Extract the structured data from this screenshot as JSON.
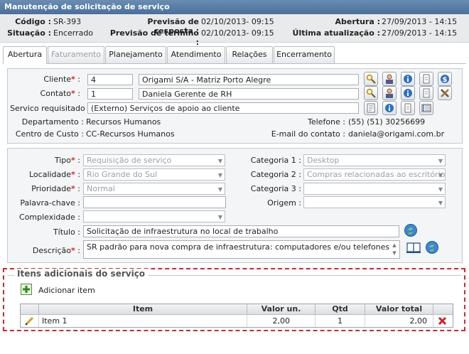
{
  "window": {
    "title": "Manutenção de solicitação de serviço"
  },
  "header": {
    "codigo_label": "Código :",
    "codigo": "SR-393",
    "situacao_label": "Situação :",
    "situacao": "Encerrado",
    "prev_resp_label": "Previsão de resposta :",
    "prev_resp": "02/10/2013- 09:15",
    "prev_term_label": "Previsão de término :",
    "prev_term": "02/10/2013- 09:15",
    "abertura_label": "Abertura :",
    "abertura": "27/09/2013 - 14:15",
    "ultima_label": "Última atualização :",
    "ultima": "27/09/2013 - 14:15"
  },
  "tabs": [
    {
      "label": "Abertura",
      "active": true
    },
    {
      "label": "Faturamento",
      "disabled": true
    },
    {
      "label": "Planejamento"
    },
    {
      "label": "Atendimento"
    },
    {
      "label": "Relações"
    },
    {
      "label": "Encerramento"
    }
  ],
  "client": {
    "cliente_label": "Cliente",
    "cliente_id": "4",
    "cliente_name": "Origami S/A - Matriz Porto Alegre",
    "contato_label": "Contato",
    "contato_id": "1",
    "contato_name": "Daniela Gerente de RH",
    "servico_label": "Servico requisitado :",
    "servico": "(Externo) Serviços de apoio ao cliente",
    "departamento_label": "Departamento :",
    "departamento": "Recursos Humanos",
    "telefone_label": "Telefone :",
    "telefone": "(55) (51) 30256699",
    "centro_label": "Centro de Custo :",
    "centro": "CC-Recursos Humanos",
    "email_label": "E-mail do contato :",
    "email": "daniela@origami.com.br"
  },
  "details": {
    "tipo_label": "Tipo",
    "tipo": "Requisição de serviço",
    "localidade_label": "Localidade",
    "localidade": "Rio Grande do Sul",
    "prioridade_label": "Prioridade",
    "prioridade": "Normal",
    "palavra_label": "Palavra-chave :",
    "palavra": "",
    "complexidade_label": "Complexidade :",
    "complexidade": "",
    "cat1_label": "Categoria 1 :",
    "cat1": "Desktop",
    "cat2_label": "Categoria 2 :",
    "cat2": "Compras relacionadas ao escritório",
    "cat3_label": "Categoria 3 :",
    "cat3": "",
    "origem_label": "Origem :",
    "origem": "",
    "titulo_label": "Título :",
    "titulo": "Solicitação de infraestrutura no local de trabalho",
    "descricao_label": "Descrição",
    "descricao": "SR padrão para nova compra de infraestrutura: computadores e/ou telefones"
  },
  "items": {
    "legend": "Itens adicionais do serviço",
    "add_label": "Adicionar item",
    "columns": [
      "Item",
      "Valor un.",
      "Qtd",
      "Valor total"
    ],
    "rows": [
      {
        "item": "Item 1",
        "valor_un": "2,00",
        "qtd": "1",
        "valor_total": "2,00"
      }
    ]
  },
  "colors": {
    "title_bar": "#4a6f99",
    "required": "#e0202a",
    "highlight_border": "#d9262c"
  }
}
